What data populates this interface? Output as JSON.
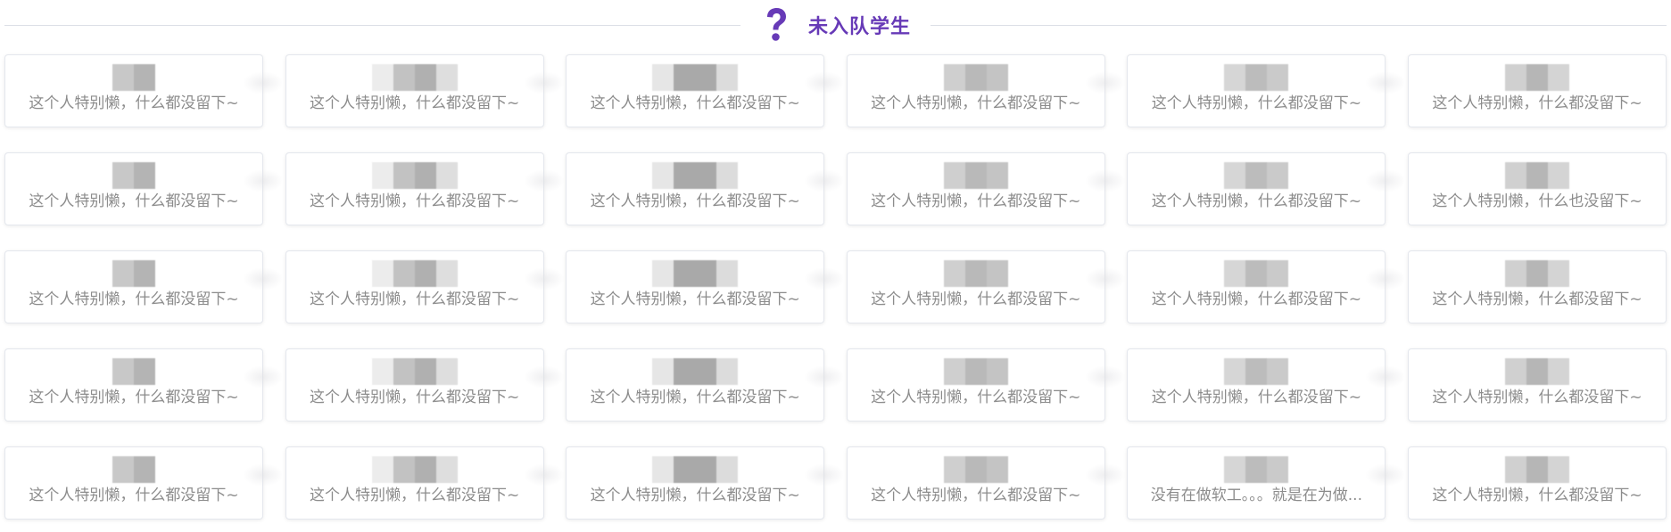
{
  "section": {
    "title": "未入队学生",
    "icon": "question-mark-icon",
    "accent_color": "#673ab7"
  },
  "students": [
    {
      "bio": "这个人特别懒，什么都没留下~"
    },
    {
      "bio": "这个人特别懒，什么都没留下~"
    },
    {
      "bio": "这个人特别懒，什么都没留下~"
    },
    {
      "bio": "这个人特别懒，什么都没留下~"
    },
    {
      "bio": "这个人特别懒，什么都没留下~"
    },
    {
      "bio": "这个人特别懒，什么都没留下~"
    },
    {
      "bio": "这个人特别懒，什么都没留下~"
    },
    {
      "bio": "这个人特别懒，什么都没留下~"
    },
    {
      "bio": "这个人特别懒，什么都没留下~"
    },
    {
      "bio": "这个人特别懒，什么都没留下~"
    },
    {
      "bio": "这个人特别懒，什么都没留下~"
    },
    {
      "bio": "这个人特别懒，什么也没留下~"
    },
    {
      "bio": "这个人特别懒，什么都没留下~"
    },
    {
      "bio": "这个人特别懒，什么都没留下~"
    },
    {
      "bio": "这个人特别懒，什么都没留下~"
    },
    {
      "bio": "这个人特别懒，什么都没留下~"
    },
    {
      "bio": "这个人特别懒，什么都没留下~"
    },
    {
      "bio": "这个人特别懒，什么都没留下~"
    },
    {
      "bio": "这个人特别懒，什么都没留下~"
    },
    {
      "bio": "这个人特别懒，什么都没留下~"
    },
    {
      "bio": "这个人特别懒，什么都没留下~"
    },
    {
      "bio": "这个人特别懒，什么都没留下~"
    },
    {
      "bio": "这个人特别懒，什么都没留下~"
    },
    {
      "bio": "这个人特别懒，什么都没留下~"
    },
    {
      "bio": "这个人特别懒，什么都没留下~"
    },
    {
      "bio": "这个人特别懒，什么都没留下~"
    },
    {
      "bio": "这个人特别懒，什么都没留下~"
    },
    {
      "bio": "这个人特别懒，什么都没留下~"
    },
    {
      "bio": "没有在做软工。。。就是在为做..."
    },
    {
      "bio": "这个人特别懒，什么都没留下~"
    }
  ]
}
